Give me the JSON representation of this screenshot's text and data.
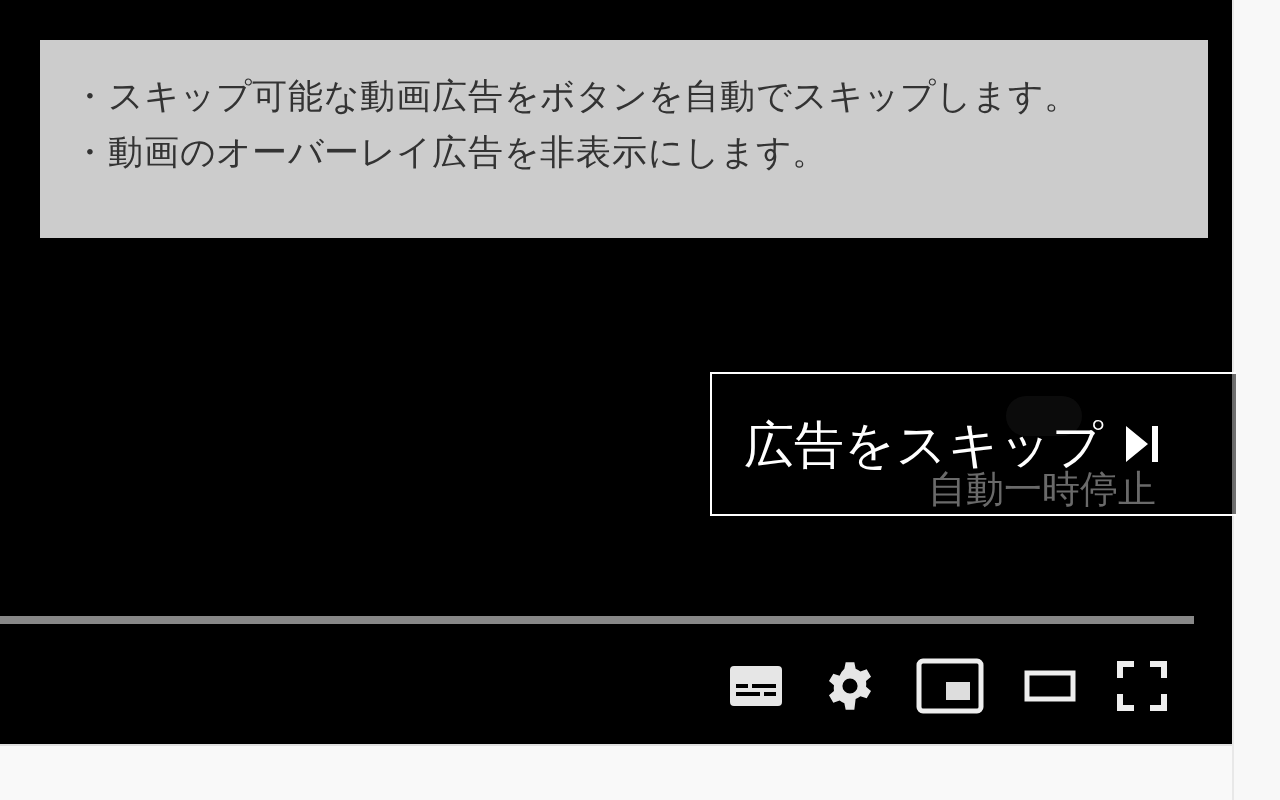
{
  "info_box": {
    "lines": [
      "・スキップ可能な動画広告をボタンを自動でスキップします。",
      "・動画のオーバーレイ広告を非表示にします。"
    ]
  },
  "player": {
    "autopause": {
      "label": "自動一時停止",
      "on": false
    },
    "skip_button": {
      "label": "広告をスキップ"
    },
    "progress": {
      "level": 1
    }
  }
}
